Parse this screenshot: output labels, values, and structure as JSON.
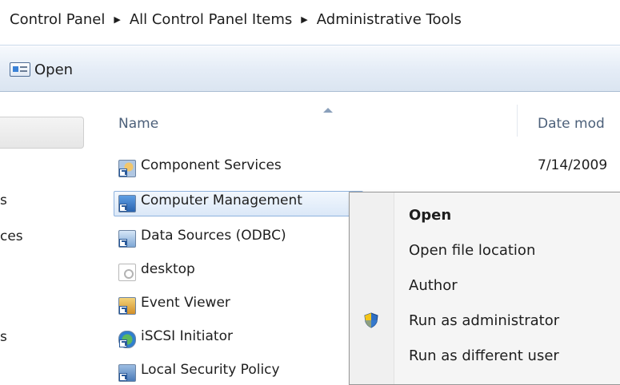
{
  "breadcrumb": {
    "items": [
      "Control Panel",
      "All Control Panel Items",
      "Administrative Tools"
    ]
  },
  "toolbar": {
    "open_label": "Open"
  },
  "nav": {
    "fragments": [
      "s",
      "ces",
      "s"
    ]
  },
  "columns": {
    "name": "Name",
    "date": "Date mod"
  },
  "files": [
    {
      "name": "Component Services",
      "date": "7/14/2009",
      "icon": "component-services-icon"
    },
    {
      "name": "Computer Management",
      "date": "",
      "icon": "computer-management-icon",
      "selected": true
    },
    {
      "name": "Data Sources (ODBC)",
      "date": "",
      "icon": "data-sources-icon"
    },
    {
      "name": "desktop",
      "date": "",
      "icon": "desktop-ini-icon"
    },
    {
      "name": "Event Viewer",
      "date": "",
      "icon": "event-viewer-icon"
    },
    {
      "name": "iSCSI Initiator",
      "date": "",
      "icon": "iscsi-icon"
    },
    {
      "name": "Local Security Policy",
      "date": "",
      "icon": "local-security-policy-icon"
    }
  ],
  "context_menu": {
    "items": [
      {
        "label": "Open",
        "default": true
      },
      {
        "label": "Open file location"
      },
      {
        "label": "Author"
      },
      {
        "label": "Run as administrator",
        "icon": "uac-shield-icon"
      },
      {
        "label": "Run as different user"
      }
    ]
  },
  "colors": {
    "selection": "#dbe8f8",
    "selection_border": "#8fb3de",
    "toolbar": "#e4ecf6"
  }
}
